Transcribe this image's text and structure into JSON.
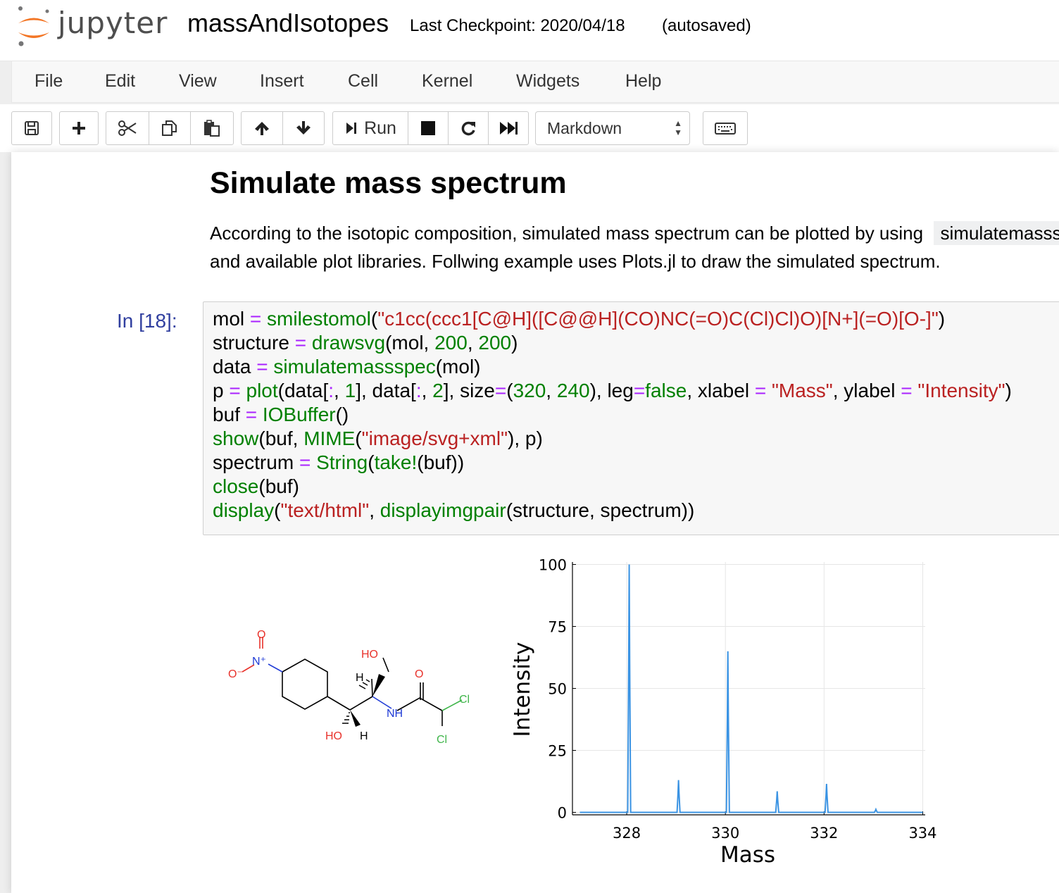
{
  "header": {
    "logo_text": "jupyter",
    "notebook_name": "massAndIsotopes",
    "checkpoint": "Last Checkpoint: 2020/04/18",
    "autosave": "(autosaved)"
  },
  "menu": [
    "File",
    "Edit",
    "View",
    "Insert",
    "Cell",
    "Kernel",
    "Widgets",
    "Help"
  ],
  "toolbar": {
    "run_label": "Run",
    "cell_type": "Markdown"
  },
  "markdown": {
    "heading": "Simulate mass spectrum",
    "para1_text": "According to the isotopic composition, simulated mass spectrum can be plotted by using",
    "para1_code": "simulatemassspec",
    "para2_text": "and available plot libraries. Follwing example uses Plots.jl to draw the simulated spectrum."
  },
  "cell": {
    "prompt": "In [18]:",
    "lines": [
      [
        [
          "mol ",
          ""
        ],
        [
          "=",
          "op"
        ],
        [
          " ",
          ""
        ],
        [
          "smilestomol",
          "fn"
        ],
        [
          "(",
          ""
        ],
        [
          "\"c1cc(ccc1[C@H]([C@@H](CO)NC(=O)C(Cl)Cl)O)[N+](=O)[O-]\"",
          "str"
        ],
        [
          ")",
          ""
        ]
      ],
      [
        [
          "structure ",
          ""
        ],
        [
          "=",
          "op"
        ],
        [
          " ",
          ""
        ],
        [
          "drawsvg",
          "fn"
        ],
        [
          "(mol, ",
          ""
        ],
        [
          "200",
          "num"
        ],
        [
          ", ",
          ""
        ],
        [
          "200",
          "num"
        ],
        [
          ")",
          ""
        ]
      ],
      [
        [
          "data ",
          ""
        ],
        [
          "=",
          "op"
        ],
        [
          " ",
          ""
        ],
        [
          "simulatemassspec",
          "fn"
        ],
        [
          "(mol)",
          ""
        ]
      ],
      [
        [
          "p ",
          ""
        ],
        [
          "=",
          "op"
        ],
        [
          " ",
          ""
        ],
        [
          "plot",
          "fn"
        ],
        [
          "(data[",
          ""
        ],
        [
          ":",
          "op"
        ],
        [
          ", ",
          ""
        ],
        [
          "1",
          "num"
        ],
        [
          "], data[",
          ""
        ],
        [
          ":",
          "op"
        ],
        [
          ", ",
          ""
        ],
        [
          "2",
          "num"
        ],
        [
          "], size",
          ""
        ],
        [
          "=",
          "op"
        ],
        [
          "(",
          ""
        ],
        [
          "320",
          "num"
        ],
        [
          ", ",
          ""
        ],
        [
          "240",
          "num"
        ],
        [
          "), leg",
          ""
        ],
        [
          "=",
          "op"
        ],
        [
          "false",
          "fn"
        ],
        [
          ", xlabel ",
          ""
        ],
        [
          "=",
          "op"
        ],
        [
          " ",
          ""
        ],
        [
          "\"Mass\"",
          "str"
        ],
        [
          ", ylabel ",
          ""
        ],
        [
          "=",
          "op"
        ],
        [
          " ",
          ""
        ],
        [
          "\"Intensity\"",
          "str"
        ],
        [
          ")",
          ""
        ]
      ],
      [
        [
          "buf ",
          ""
        ],
        [
          "=",
          "op"
        ],
        [
          " ",
          ""
        ],
        [
          "IOBuffer",
          "fn"
        ],
        [
          "()",
          ""
        ]
      ],
      [
        [
          "show",
          "fn"
        ],
        [
          "(buf, ",
          ""
        ],
        [
          "MIME",
          "fn"
        ],
        [
          "(",
          ""
        ],
        [
          "\"image/svg+xml\"",
          "str"
        ],
        [
          "), p)",
          ""
        ]
      ],
      [
        [
          "spectrum ",
          ""
        ],
        [
          "=",
          "op"
        ],
        [
          " ",
          ""
        ],
        [
          "String",
          "fn"
        ],
        [
          "(",
          ""
        ],
        [
          "take!",
          "fn"
        ],
        [
          "(buf))",
          ""
        ]
      ],
      [
        [
          "close",
          "fn"
        ],
        [
          "(buf)",
          ""
        ]
      ],
      [
        [
          "display",
          "fn"
        ],
        [
          "(",
          ""
        ],
        [
          "\"text/html\"",
          "str"
        ],
        [
          ", ",
          ""
        ],
        [
          "displayimgpair",
          "fn"
        ],
        [
          "(structure, spectrum))",
          ""
        ]
      ]
    ]
  },
  "molecule": {
    "atoms": [
      "O",
      "O⁻",
      "N⁺",
      "HO",
      "H",
      "O",
      "Cl",
      "NH",
      "HO",
      "H",
      "Cl"
    ],
    "colors": {
      "oxygen": "#e8322b",
      "nitrogen": "#1f3bd6",
      "chlorine": "#3fb54a",
      "bond": "#000000"
    }
  },
  "chart_data": {
    "type": "line",
    "xlabel": "Mass",
    "ylabel": "Intensity",
    "xlim": [
      326.9,
      334.05
    ],
    "ylim": [
      -1,
      101
    ],
    "xticks": [
      328,
      330,
      332,
      334
    ],
    "yticks": [
      0,
      25,
      50,
      75,
      100
    ],
    "grid": true,
    "legend": false,
    "line_color": "#3a93e3",
    "peaks": [
      {
        "x": 328.05,
        "y": 100
      },
      {
        "x": 329.05,
        "y": 13
      },
      {
        "x": 330.05,
        "y": 65
      },
      {
        "x": 331.05,
        "y": 8.5
      },
      {
        "x": 332.05,
        "y": 11.5
      },
      {
        "x": 333.05,
        "y": 1.2
      }
    ]
  }
}
